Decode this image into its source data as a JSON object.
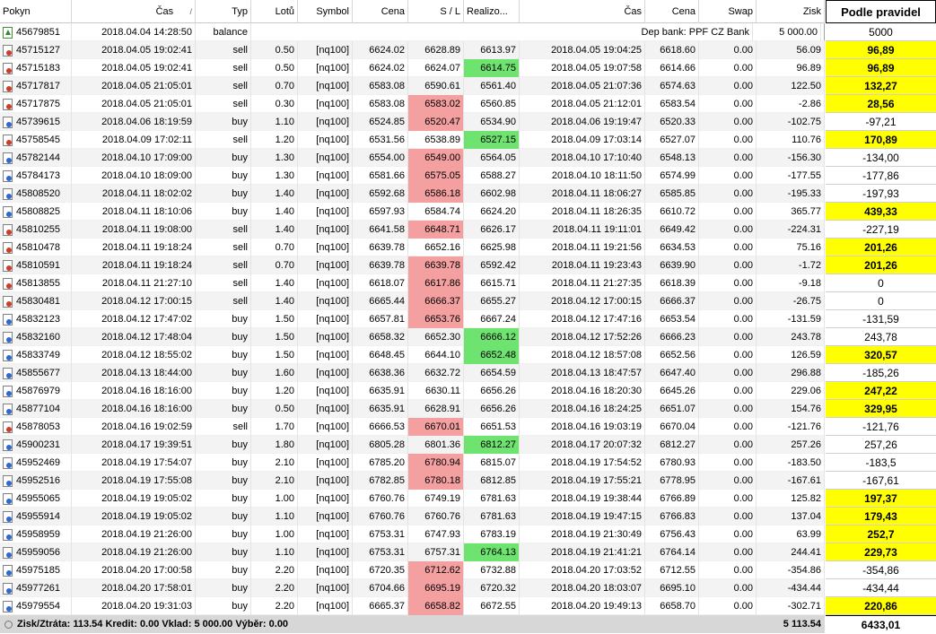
{
  "headers": {
    "order": "Pokyn",
    "open_time": "Čas",
    "open_time_sort": "/",
    "type": "Typ",
    "lots": "Lotů",
    "symbol": "Symbol",
    "price": "Cena",
    "sl": "S / L",
    "realized": "Realizo...",
    "close_time": "Čas",
    "close_price": "Cena",
    "swap": "Swap",
    "profit": "Zisk"
  },
  "balance_row": {
    "order": "45679851",
    "time": "2018.04.04 14:28:50",
    "type": "balance",
    "comment": "Dep bank: PPF CZ Bank",
    "profit": "5 000.00"
  },
  "rows": [
    [
      "45715127",
      "2018.04.05 19:02:41",
      "sell",
      "0.50",
      "[nq100]",
      "6624.02",
      "6628.89",
      "6613.97",
      "2018.04.05 19:04:25",
      "6618.60",
      "0.00",
      "56.09",
      "",
      ""
    ],
    [
      "45715183",
      "2018.04.05 19:02:41",
      "sell",
      "0.50",
      "[nq100]",
      "6624.02",
      "6624.07",
      "6614.75",
      "2018.04.05 19:07:58",
      "6614.66",
      "0.00",
      "96.89",
      "",
      "green"
    ],
    [
      "45717817",
      "2018.04.05 21:05:01",
      "sell",
      "0.70",
      "[nq100]",
      "6583.08",
      "6590.61",
      "6561.40",
      "2018.04.05 21:07:36",
      "6574.63",
      "0.00",
      "122.50",
      "",
      ""
    ],
    [
      "45717875",
      "2018.04.05 21:05:01",
      "sell",
      "0.30",
      "[nq100]",
      "6583.08",
      "6583.02",
      "6560.85",
      "2018.04.05 21:12:01",
      "6583.54",
      "0.00",
      "-2.86",
      "red",
      ""
    ],
    [
      "45739615",
      "2018.04.06 18:19:59",
      "buy",
      "1.10",
      "[nq100]",
      "6524.85",
      "6520.47",
      "6534.90",
      "2018.04.06 19:19:47",
      "6520.33",
      "0.00",
      "-102.75",
      "red",
      ""
    ],
    [
      "45758545",
      "2018.04.09 17:02:11",
      "sell",
      "1.20",
      "[nq100]",
      "6531.56",
      "6538.89",
      "6527.15",
      "2018.04.09 17:03:14",
      "6527.07",
      "0.00",
      "110.76",
      "",
      "green"
    ],
    [
      "45782144",
      "2018.04.10 17:09:00",
      "buy",
      "1.30",
      "[nq100]",
      "6554.00",
      "6549.00",
      "6564.05",
      "2018.04.10 17:10:40",
      "6548.13",
      "0.00",
      "-156.30",
      "red",
      ""
    ],
    [
      "45784173",
      "2018.04.10 18:09:00",
      "buy",
      "1.30",
      "[nq100]",
      "6581.66",
      "6575.05",
      "6588.27",
      "2018.04.10 18:11:50",
      "6574.99",
      "0.00",
      "-177.55",
      "red",
      ""
    ],
    [
      "45808520",
      "2018.04.11 18:02:02",
      "buy",
      "1.40",
      "[nq100]",
      "6592.68",
      "6586.18",
      "6602.98",
      "2018.04.11 18:06:27",
      "6585.85",
      "0.00",
      "-195.33",
      "red",
      ""
    ],
    [
      "45808825",
      "2018.04.11 18:10:06",
      "buy",
      "1.40",
      "[nq100]",
      "6597.93",
      "6584.74",
      "6624.20",
      "2018.04.11 18:26:35",
      "6610.72",
      "0.00",
      "365.77",
      "",
      ""
    ],
    [
      "45810255",
      "2018.04.11 19:08:00",
      "sell",
      "1.40",
      "[nq100]",
      "6641.58",
      "6648.71",
      "6626.17",
      "2018.04.11 19:11:01",
      "6649.42",
      "0.00",
      "-224.31",
      "red",
      ""
    ],
    [
      "45810478",
      "2018.04.11 19:18:24",
      "sell",
      "0.70",
      "[nq100]",
      "6639.78",
      "6652.16",
      "6625.98",
      "2018.04.11 19:21:56",
      "6634.53",
      "0.00",
      "75.16",
      "",
      ""
    ],
    [
      "45810591",
      "2018.04.11 19:18:24",
      "sell",
      "0.70",
      "[nq100]",
      "6639.78",
      "6639.78",
      "6592.42",
      "2018.04.11 19:23:43",
      "6639.90",
      "0.00",
      "-1.72",
      "red",
      ""
    ],
    [
      "45813855",
      "2018.04.11 21:27:10",
      "sell",
      "1.40",
      "[nq100]",
      "6618.07",
      "6617.86",
      "6615.71",
      "2018.04.11 21:27:35",
      "6618.39",
      "0.00",
      "-9.18",
      "red",
      ""
    ],
    [
      "45830481",
      "2018.04.12 17:00:15",
      "sell",
      "1.40",
      "[nq100]",
      "6665.44",
      "6666.37",
      "6655.27",
      "2018.04.12 17:00:15",
      "6666.37",
      "0.00",
      "-26.75",
      "red",
      ""
    ],
    [
      "45832123",
      "2018.04.12 17:47:02",
      "buy",
      "1.50",
      "[nq100]",
      "6657.81",
      "6653.76",
      "6667.24",
      "2018.04.12 17:47:16",
      "6653.54",
      "0.00",
      "-131.59",
      "red",
      ""
    ],
    [
      "45832160",
      "2018.04.12 17:48:04",
      "buy",
      "1.50",
      "[nq100]",
      "6658.32",
      "6652.30",
      "6666.12",
      "2018.04.12 17:52:26",
      "6666.23",
      "0.00",
      "243.78",
      "",
      "green"
    ],
    [
      "45833749",
      "2018.04.12 18:55:02",
      "buy",
      "1.50",
      "[nq100]",
      "6648.45",
      "6644.10",
      "6652.48",
      "2018.04.12 18:57:08",
      "6652.56",
      "0.00",
      "126.59",
      "",
      "green"
    ],
    [
      "45855677",
      "2018.04.13 18:44:00",
      "buy",
      "1.60",
      "[nq100]",
      "6638.36",
      "6632.72",
      "6654.59",
      "2018.04.13 18:47:57",
      "6647.40",
      "0.00",
      "296.88",
      "",
      ""
    ],
    [
      "45876979",
      "2018.04.16 18:16:00",
      "buy",
      "1.20",
      "[nq100]",
      "6635.91",
      "6630.11",
      "6656.26",
      "2018.04.16 18:20:30",
      "6645.26",
      "0.00",
      "229.06",
      "",
      ""
    ],
    [
      "45877104",
      "2018.04.16 18:16:00",
      "buy",
      "0.50",
      "[nq100]",
      "6635.91",
      "6628.91",
      "6656.26",
      "2018.04.16 18:24:25",
      "6651.07",
      "0.00",
      "154.76",
      "",
      ""
    ],
    [
      "45878053",
      "2018.04.16 19:02:59",
      "sell",
      "1.70",
      "[nq100]",
      "6666.53",
      "6670.01",
      "6651.53",
      "2018.04.16 19:03:19",
      "6670.04",
      "0.00",
      "-121.76",
      "red",
      ""
    ],
    [
      "45900231",
      "2018.04.17 19:39:51",
      "buy",
      "1.80",
      "[nq100]",
      "6805.28",
      "6801.36",
      "6812.27",
      "2018.04.17 20:07:32",
      "6812.27",
      "0.00",
      "257.26",
      "",
      "green"
    ],
    [
      "45952469",
      "2018.04.19 17:54:07",
      "buy",
      "2.10",
      "[nq100]",
      "6785.20",
      "6780.94",
      "6815.07",
      "2018.04.19 17:54:52",
      "6780.93",
      "0.00",
      "-183.50",
      "red",
      ""
    ],
    [
      "45952516",
      "2018.04.19 17:55:08",
      "buy",
      "2.10",
      "[nq100]",
      "6782.85",
      "6780.18",
      "6812.85",
      "2018.04.19 17:55:21",
      "6778.95",
      "0.00",
      "-167.61",
      "red",
      ""
    ],
    [
      "45955065",
      "2018.04.19 19:05:02",
      "buy",
      "1.00",
      "[nq100]",
      "6760.76",
      "6749.19",
      "6781.63",
      "2018.04.19 19:38:44",
      "6766.89",
      "0.00",
      "125.82",
      "",
      ""
    ],
    [
      "45955914",
      "2018.04.19 19:05:02",
      "buy",
      "1.10",
      "[nq100]",
      "6760.76",
      "6760.76",
      "6781.63",
      "2018.04.19 19:47:15",
      "6766.83",
      "0.00",
      "137.04",
      "",
      ""
    ],
    [
      "45958959",
      "2018.04.19 21:26:00",
      "buy",
      "1.00",
      "[nq100]",
      "6753.31",
      "6747.93",
      "6783.19",
      "2018.04.19 21:30:49",
      "6756.43",
      "0.00",
      "63.99",
      "",
      ""
    ],
    [
      "45959056",
      "2018.04.19 21:26:00",
      "buy",
      "1.10",
      "[nq100]",
      "6753.31",
      "6757.31",
      "6764.13",
      "2018.04.19 21:41:21",
      "6764.14",
      "0.00",
      "244.41",
      "",
      "green"
    ],
    [
      "45975185",
      "2018.04.20 17:00:58",
      "buy",
      "2.20",
      "[nq100]",
      "6720.35",
      "6712.62",
      "6732.88",
      "2018.04.20 17:03:52",
      "6712.55",
      "0.00",
      "-354.86",
      "red",
      ""
    ],
    [
      "45977261",
      "2018.04.20 17:58:01",
      "buy",
      "2.20",
      "[nq100]",
      "6704.66",
      "6695.19",
      "6720.32",
      "2018.04.20 18:03:07",
      "6695.10",
      "0.00",
      "-434.44",
      "red",
      ""
    ],
    [
      "45979554",
      "2018.04.20 19:31:03",
      "buy",
      "2.20",
      "[nq100]",
      "6665.37",
      "6658.82",
      "6672.55",
      "2018.04.20 19:49:13",
      "6658.70",
      "0.00",
      "-302.71",
      "red",
      ""
    ]
  ],
  "footer": {
    "summary": "Zisk/Ztráta: 113.54  Kredit: 0.00  Vklad: 5 000.00  Výběr: 0.00",
    "total": "5 113.54"
  },
  "side": {
    "header": "Podle pravidel",
    "balance": "5000",
    "values": [
      [
        "96,89",
        true
      ],
      [
        "96,89",
        true
      ],
      [
        "132,27",
        true
      ],
      [
        "28,56",
        true
      ],
      [
        "-97,21",
        false
      ],
      [
        "170,89",
        true
      ],
      [
        "-134,00",
        false
      ],
      [
        "-177,86",
        false
      ],
      [
        "-197,93",
        false
      ],
      [
        "439,33",
        true
      ],
      [
        "-227,19",
        false
      ],
      [
        "201,26",
        true
      ],
      [
        "201,26",
        true
      ],
      [
        "0",
        false
      ],
      [
        "0",
        false
      ],
      [
        "-131,59",
        false
      ],
      [
        "243,78",
        false
      ],
      [
        "320,57",
        true
      ],
      [
        "-185,26",
        false
      ],
      [
        "247,22",
        true
      ],
      [
        "329,95",
        true
      ],
      [
        "-121,76",
        false
      ],
      [
        "257,26",
        false
      ],
      [
        "-183,5",
        false
      ],
      [
        "-167,61",
        false
      ],
      [
        "197,37",
        true
      ],
      [
        "179,43",
        true
      ],
      [
        "252,7",
        true
      ],
      [
        "229,73",
        true
      ],
      [
        "-354,86",
        false
      ],
      [
        "-434,44",
        false
      ],
      [
        "220,86",
        true
      ]
    ],
    "total": "6433,01"
  },
  "colors": {
    "red_cell": "#f4a0a0",
    "green_cell": "#6fe36f",
    "highlight": "#ffff00"
  }
}
